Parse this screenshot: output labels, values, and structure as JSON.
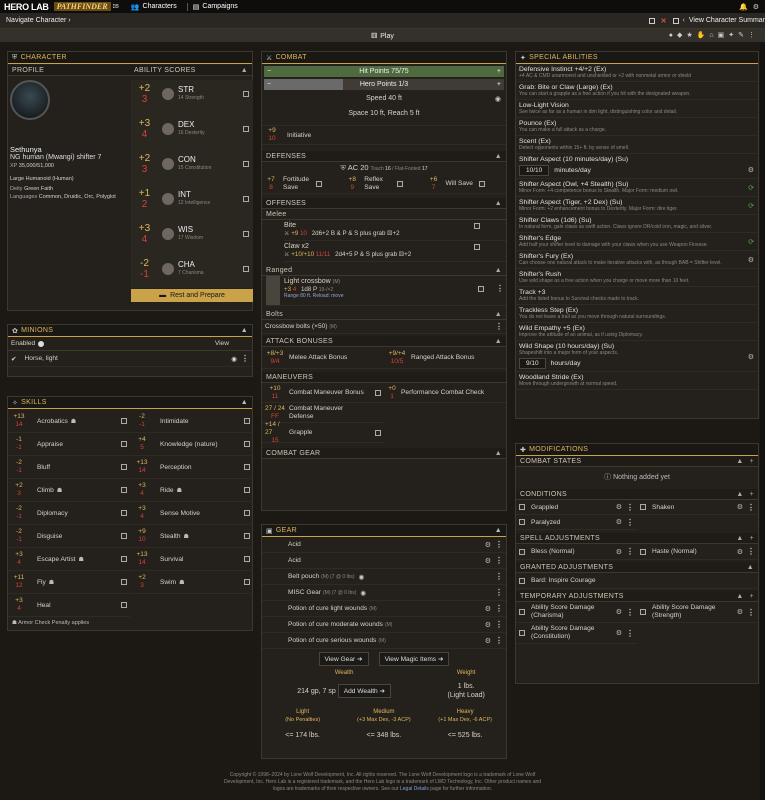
{
  "top": {
    "logo1": "HERO LAB",
    "logo2": "PATHFINDER",
    "logo_suffix": "ɪʙ",
    "characters": "Characters",
    "campaigns": "Campaigns"
  },
  "nav": {
    "back": "Navigate Character",
    "summary": "View Character Summar"
  },
  "play": "Play",
  "character": {
    "header": "Character",
    "profile": "Profile",
    "ability_scores": "Ability Scores",
    "name": "Sethunya",
    "race": "NG human (Mwangi) shifter 7",
    "xp_label": "XP",
    "xp": "35,000/51,000",
    "size": "Large Humanoid (Human)",
    "deity_label": "Deity",
    "deity": "Green Faith",
    "languages_label": "Languages",
    "languages": "Common, Druidic, Orc, Polyglot",
    "rest": "Rest and Prepare",
    "abilities": [
      {
        "mod": "+2",
        "mod2": "3",
        "abbr": "STR",
        "score": "14",
        "name": "Strength"
      },
      {
        "mod": "+3",
        "mod2": "4",
        "abbr": "DEX",
        "score": "16",
        "name": "Dexterity"
      },
      {
        "mod": "+2",
        "mod2": "3",
        "abbr": "CON",
        "score": "15",
        "name": "Constitution"
      },
      {
        "mod": "+1",
        "mod2": "2",
        "abbr": "INT",
        "score": "12",
        "name": "Intelligence"
      },
      {
        "mod": "+3",
        "mod2": "4",
        "abbr": "WIS",
        "score": "17",
        "name": "Wisdom"
      },
      {
        "mod": "-2",
        "mod2": "-1",
        "abbr": "CHA",
        "score": "7",
        "name": "Charisma"
      }
    ]
  },
  "minions": {
    "header": "Minions",
    "enabled": "Enabled",
    "view": "View",
    "item": "Horse, light"
  },
  "skills": {
    "header": "Skills",
    "note": "Armor Check Penalty applies",
    "left": [
      {
        "v1": "+13",
        "v2": "14",
        "name": "Acrobatics",
        "acp": true
      },
      {
        "v1": "-1",
        "v2": "-1",
        "name": "Appraise",
        "acp": false
      },
      {
        "v1": "-2",
        "v2": "-1",
        "name": "Bluff",
        "acp": false
      },
      {
        "v1": "+2",
        "v2": "3",
        "name": "Climb",
        "acp": true
      },
      {
        "v1": "-2",
        "v2": "-1",
        "name": "Diplomacy",
        "acp": false
      },
      {
        "v1": "-2",
        "v2": "-1",
        "name": "Disguise",
        "acp": false
      },
      {
        "v1": "+3",
        "v2": "4",
        "name": "Escape Artist",
        "acp": true
      },
      {
        "v1": "+11",
        "v2": "12",
        "name": "Fly",
        "acp": true
      },
      {
        "v1": "+3",
        "v2": "4",
        "name": "Heal",
        "acp": false
      }
    ],
    "right": [
      {
        "v1": "-2",
        "v2": "-1",
        "name": "Intimidate",
        "acp": false
      },
      {
        "v1": "+4",
        "v2": "5",
        "name": "Knowledge (nature)",
        "acp": false
      },
      {
        "v1": "+13",
        "v2": "14",
        "name": "Perception",
        "acp": false
      },
      {
        "v1": "+3",
        "v2": "4",
        "name": "Ride",
        "acp": true
      },
      {
        "v1": "+3",
        "v2": "4",
        "name": "Sense Motive",
        "acp": false
      },
      {
        "v1": "+9",
        "v2": "10",
        "name": "Stealth",
        "acp": true
      },
      {
        "v1": "+13",
        "v2": "14",
        "name": "Survival",
        "acp": false
      },
      {
        "v1": "+2",
        "v2": "3",
        "name": "Swim",
        "acp": true
      }
    ]
  },
  "combat": {
    "header": "Combat",
    "hp": "Hit Points 75/75",
    "hero": "Hero Points 1/3",
    "speed": "Speed 40 ft",
    "space": "Space 10 ft, Reach 5 ft",
    "init_v1": "+9",
    "init_v2": "10",
    "init": "Initiative",
    "defenses": "Defenses",
    "ac": "AC 20",
    "touch": "Touch",
    "touch_v": "16",
    "ff": "Flat-Footed",
    "ff_v": "17",
    "saves": [
      {
        "v1": "+7",
        "v2": "8",
        "name": "Fortitude Save"
      },
      {
        "v1": "+8",
        "v2": "9",
        "name": "Reflex Save"
      },
      {
        "v1": "+6",
        "v2": "7",
        "name": "Will Save"
      }
    ],
    "offenses": "Offenses",
    "melee": "Melee",
    "bite": "Bite",
    "bite_line": "+9",
    "bite_line2": "10",
    "bite_dmg": "2d6+2 B & P & S plus grab",
    "bite_plus": "+2",
    "claw": "Claw x2",
    "claw_line": "+10/+10",
    "claw_line2": "11/11",
    "claw_dmg": "2d4+5 P & S plus grab",
    "claw_plus": "+2",
    "ranged": "Ranged",
    "xbow": "Light crossbow",
    "xbow_m": "(M)",
    "xbow_atk": "+3",
    "xbow_atk2": "4",
    "xbow_dmg": "1d8 P",
    "xbow_crit": "19-/×2",
    "xbow_range": "Range 80 ft. Reload: move",
    "bolts": "Bolts",
    "bolts_item": "Crossbow bolts (×50)",
    "bolts_m": "(M)",
    "atk_bonuses": "Attack Bonuses",
    "mab_v1": "+8/+3",
    "mab_v2": "9/4",
    "mab": "Melee Attack Bonus",
    "rab_v1": "+9/+4",
    "rab_v2": "10/5",
    "rab": "Ranged Attack Bonus",
    "maneuvers": "Maneuvers",
    "cmb_v1": "+10",
    "cmb_v2": "11",
    "cmb": "Combat Maneuver Bonus",
    "pcc_v1": "+0",
    "pcc_v2": "1",
    "pcc": "Performance Combat Check",
    "cmd_v1": "27 / 24",
    "cmd_v2": "FF",
    "cmd": "Combat Maneuver Defense",
    "grap_v1": "+14 / 27",
    "grap_v2": "15",
    "grap": "Grapple",
    "combat_gear": "Combat Gear"
  },
  "gear": {
    "header": "Gear",
    "items": [
      {
        "name": "Acid",
        "meta": ""
      },
      {
        "name": "Acid",
        "meta": ""
      },
      {
        "name": "Belt pouch",
        "meta": "(M) (7 @ 0 lbs)"
      },
      {
        "name": "MISC Gear",
        "meta": "(M) (7 @ 0 lbs)"
      },
      {
        "name": "Potion of cure light wounds",
        "meta": "(M)"
      },
      {
        "name": "Potion of cure moderate wounds",
        "meta": "(M)"
      },
      {
        "name": "Potion of cure serious wounds",
        "meta": "(M)"
      }
    ],
    "view_gear": "View Gear",
    "view_magic": "View Magic Items",
    "wealth_h": "Wealth",
    "weight_h": "Weight",
    "wealth": "214 gp, 7 sp",
    "add_wealth": "Add Wealth",
    "weight": "1 lbs.",
    "load": "(Light Load)",
    "loads": [
      {
        "t": "Light",
        "s": "(No Penalties)",
        "v": "<= 174 lbs."
      },
      {
        "t": "Medium",
        "s": "(+3 Max Dex, -3 ACP)",
        "v": "<= 348 lbs."
      },
      {
        "t": "Heavy",
        "s": "(+1 Max Dex, -6 ACP)",
        "v": "<= 525 lbs."
      }
    ]
  },
  "special": {
    "header": "Special Abilities",
    "items": [
      {
        "n": "Defensive Instinct +4/+2 (Ex)",
        "d": "+4 AC & CMD unarmored and unshielded or +2 with nonmetal armor or shield"
      },
      {
        "n": "Grab: Bite or Claw (Large) (Ex)",
        "d": "You can start a grapple as a free action if you hit with the designated weapon."
      },
      {
        "n": "Low-Light Vision",
        "d": "See twice as far as a human in dim light, distinguishing color and detail."
      },
      {
        "n": "Pounce (Ex)",
        "d": "You can make a full attack as a charge."
      },
      {
        "n": "Scent (Ex)",
        "d": "Detect opponents within 15+ ft. by sense of smell."
      },
      {
        "n": "Shifter Aspect (10 minutes/day) (Su)",
        "d": ""
      },
      {
        "n": "Shifter Aspect (Owl, +4 Stealth) (Su)",
        "d": "Minor Form: +4 competence bonus to Stealth. Major Form: medium owl."
      },
      {
        "n": "Shifter Aspect (Tiger, +2 Dex) (Su)",
        "d": "Minor Form: +2 enhancement bonus to Dexterity. Major Form: dire tiger."
      },
      {
        "n": "Shifter Claws (1d6) (Su)",
        "d": "In natural form, gain claws as swift action. Claws ignore DR/cold iron, magic, and silver."
      },
      {
        "n": "Shifter's Edge",
        "d": "Add half your shifter level to damage with your claws when you use Weapon Finesse."
      },
      {
        "n": "Shifter's Fury (Ex)",
        "d": "Can choose one natural attack to make iterative attacks with, as though BAB = Shifter level."
      },
      {
        "n": "Shifter's Rush",
        "d": "Use wild shape as a free action when you charge or move more than 10 feet."
      },
      {
        "n": "Track +3",
        "d": "Add the listed bonus to Survival checks made to track."
      },
      {
        "n": "Trackless Step (Ex)",
        "d": "You do not leave a trail as you move through natural surroundings."
      },
      {
        "n": "Wild Empathy +5 (Ex)",
        "d": "Improve the attitude of an animal, as if using Diplomacy."
      },
      {
        "n": "Wild Shape (10 hours/day) (Su)",
        "d": "Shapeshift into a major form of your aspects."
      },
      {
        "n": "Woodland Stride (Ex)",
        "d": "Move through undergrowth at normal speed."
      }
    ],
    "counter1": "10/10",
    "counter1_label": "minutes/day",
    "counter2": "9/10",
    "counter2_label": "hours/day"
  },
  "mods": {
    "header": "Modifications",
    "combat_states": "Combat States",
    "nothing": "Nothing added yet",
    "conditions": "Conditions",
    "grappled": "Grappled",
    "shaken": "Shaken",
    "paralyzed": "Paralyzed",
    "spell_adj": "Spell Adjustments",
    "bless": "Bless (Normal)",
    "haste": "Haste (Normal)",
    "granted": "Granted Adjustments",
    "bard": "Bard: Inspire Courage",
    "temp": "Temporary Adjustments",
    "asd_cha": "Ability Score Damage (Charisma)",
    "asd_str": "Ability Score Damage (Strength)",
    "asd_con": "Ability Score Damage (Constitution)"
  },
  "footer": {
    "line1": "Copyright © 1998–2024 by Lone Wolf Development, Inc. All rights reserved. The Lone Wolf Development logo is a trademark of Lone Wolf",
    "line2": "Development, Inc. Hero Lab is a registered trademark, and the Hero Lab logo is a trademark of LWD Technology, Inc. Other product names and",
    "line3": "logos are trademarks of their respective owners. See our",
    "legal": "Legal Details",
    "line3b": "page for further information."
  }
}
